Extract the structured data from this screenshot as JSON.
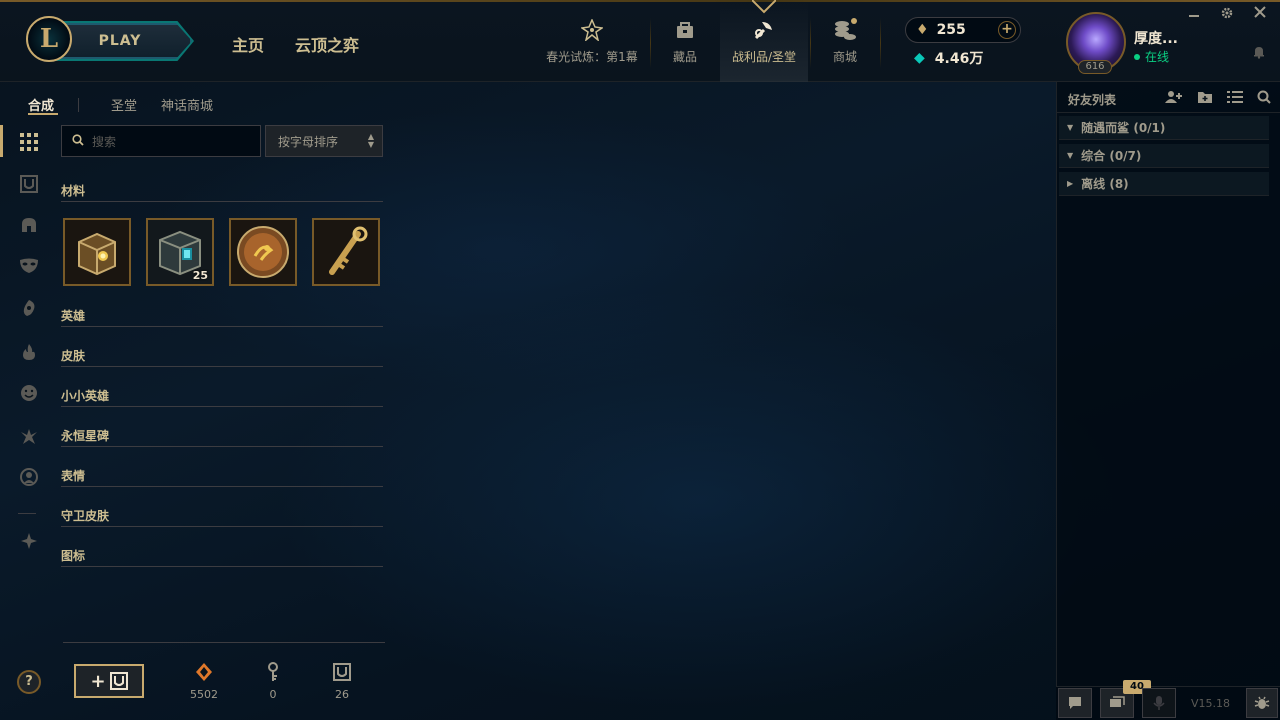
{
  "header": {
    "logo_text": "L",
    "play_label": "PLAY",
    "nav": [
      "主页",
      "云顶之弈"
    ],
    "top_buttons": [
      {
        "icon": "event-icon",
        "label": "春光试炼：第1幕"
      },
      {
        "icon": "collection-icon",
        "label": "藏品"
      },
      {
        "icon": "loot-icon",
        "label": "战利品/圣堂"
      },
      {
        "icon": "store-icon",
        "label": "商城"
      }
    ],
    "rp_amount": "255",
    "be_amount": "4.46万",
    "level": "616",
    "username": "厚度...",
    "status": "在线"
  },
  "loot": {
    "tabs": [
      "合成",
      "圣堂",
      "神话商城"
    ],
    "search_placeholder": "搜索",
    "sort_label": "按字母排序",
    "materials_header": "材料",
    "items": [
      {
        "name": "hextech-chest",
        "count": ""
      },
      {
        "name": "masterwork-chest",
        "count": "25"
      },
      {
        "name": "orb",
        "count": ""
      },
      {
        "name": "key",
        "count": ""
      }
    ],
    "categories": [
      "英雄",
      "皮肤",
      "小小英雄",
      "永恒星碑",
      "表情",
      "守卫皮肤",
      "图标"
    ],
    "resources": [
      {
        "icon": "orange-essence-icon",
        "value": "5502"
      },
      {
        "icon": "key-fragment-icon",
        "value": "0"
      },
      {
        "icon": "chest-icon",
        "value": "26"
      }
    ],
    "help_label": "?",
    "add_chest_label": "+"
  },
  "friends": {
    "title": "好友列表",
    "groups": [
      {
        "label": "随遇而鲨 (0/1)",
        "expanded": true
      },
      {
        "label": "综合 (0/7)",
        "expanded": true
      },
      {
        "label": "离线 (8)",
        "expanded": false
      }
    ],
    "chat_count": "40",
    "version": "V15.18"
  },
  "colors": {
    "gold": "#c8aa6e",
    "gold_dark": "#785a28",
    "text": "#a09b8c",
    "text_bright": "#f0e6d2",
    "online": "#0acf83",
    "accent_teal": "#0ac8b9"
  }
}
